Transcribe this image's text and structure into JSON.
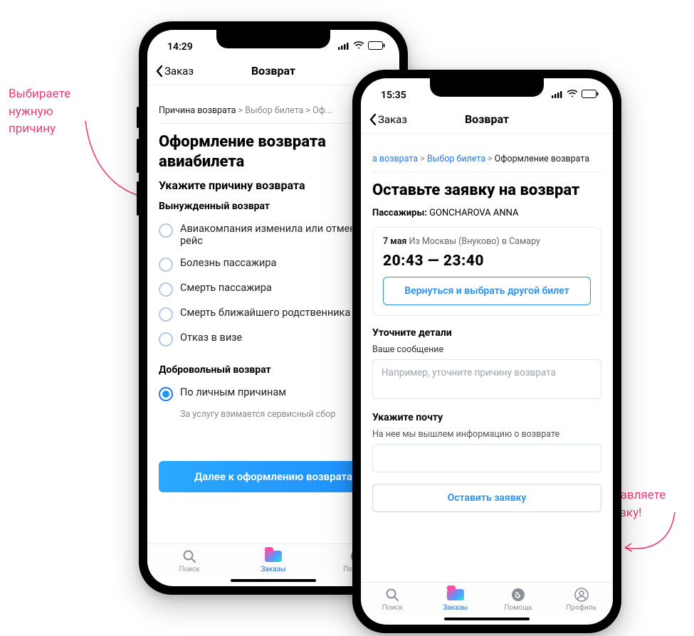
{
  "annotations": {
    "left": "Выбираете нужную причину",
    "right": "Оставляете заявку!"
  },
  "phone1": {
    "time": "14:29",
    "back": "Заказ",
    "title": "Возврат",
    "breadcrumb": {
      "step1": "Причина возврата",
      "step2": "Выбор билета",
      "step3": "Оф..."
    },
    "h1": "Оформление возврата авиабилета",
    "h2": "Укажите причину возврата",
    "group_forced": "Вынужденный возврат",
    "opts_forced": [
      "Авиакомпания изменила или отменила рейс",
      "Болезнь пассажира",
      "Смерть пассажира",
      "Смерть ближайшего родственника",
      "Отказ в визе"
    ],
    "group_vol": "Добровольный возврат",
    "opt_vol": "По личным причинам",
    "fee_note": "За услугу взимается сервисный сбор",
    "cta": "Далее к оформлению возврата"
  },
  "phone2": {
    "time": "15:35",
    "back": "Заказ",
    "title": "Возврат",
    "breadcrumb": {
      "step1": "а возврата",
      "step2": "Выбор билета",
      "step3": "Оформление возврата"
    },
    "h1": "Оставьте заявку на возврат",
    "passengers_label": "Пассажиры:",
    "passengers_value": "GONCHAROVA ANNA",
    "card": {
      "date": "7 мая",
      "route": "Из Москвы (Внуково) в Самару",
      "times": "20:43 — 23:40",
      "change_btn": "Вернуться и выбрать другой билет"
    },
    "details_title": "Уточните детали",
    "msg_label": "Ваше сообщение",
    "msg_placeholder": "Например, уточните причину возврата",
    "email_title": "Укажите почту",
    "email_hint": "На нее мы вышлем информацию о возврате",
    "submit": "Оставить заявку"
  },
  "tabs": {
    "search": "Поиск",
    "orders": "Заказы",
    "help": "Помощь",
    "profile": "Профиль"
  }
}
